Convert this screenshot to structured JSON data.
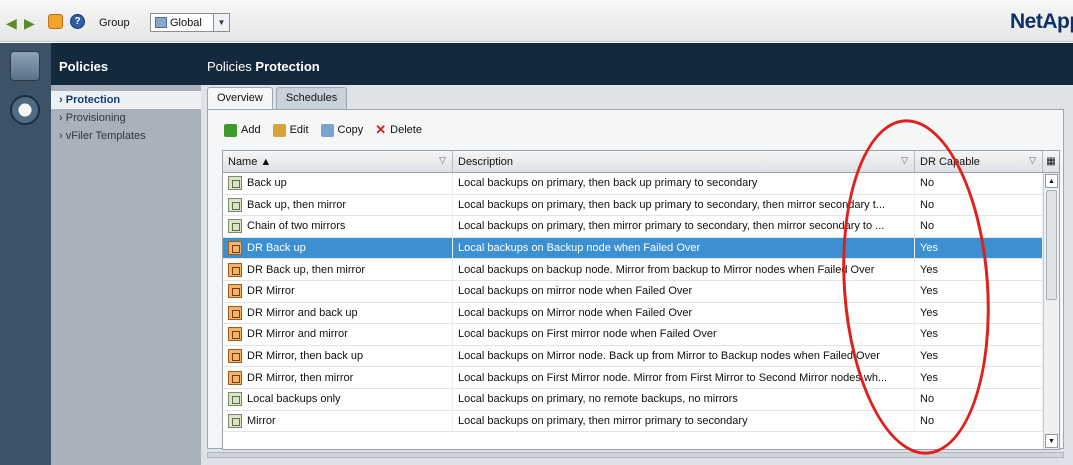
{
  "toolbar": {
    "group_label": "Group",
    "group_value": "Global",
    "brand": "NetApp"
  },
  "nav": {
    "title": "Policies",
    "items": [
      {
        "label": "Protection",
        "active": true
      },
      {
        "label": "Provisioning",
        "active": false
      },
      {
        "label": "vFiler Templates",
        "active": false
      }
    ]
  },
  "main": {
    "title_prefix": "Policies",
    "title_bold": "Protection",
    "tabs": [
      {
        "label": "Overview",
        "active": true
      },
      {
        "label": "Schedules",
        "active": false
      }
    ],
    "actions": [
      {
        "label": "Add",
        "icon": "add-icon",
        "color": "#3c9a2b"
      },
      {
        "label": "Edit",
        "icon": "edit-icon",
        "color": "#d8a43a"
      },
      {
        "label": "Copy",
        "icon": "copy-icon",
        "color": "#7aa3cf"
      },
      {
        "label": "Delete",
        "icon": "delete-icon",
        "color": "#d0201a"
      }
    ]
  },
  "table": {
    "columns": [
      "Name ▲",
      "Description",
      "DR Capable"
    ],
    "rows": [
      {
        "name": "Back up",
        "description": "Local backups on primary, then back up primary to secondary",
        "dr": "No",
        "dr_icon": false
      },
      {
        "name": "Back up, then mirror",
        "description": "Local backups on primary, then back up primary to secondary, then mirror secondary t...",
        "dr": "No",
        "dr_icon": false
      },
      {
        "name": "Chain of two mirrors",
        "description": "Local backups on primary, then mirror primary to secondary, then mirror secondary to ...",
        "dr": "No",
        "dr_icon": false
      },
      {
        "name": "DR Back up",
        "description": "Local backups on Backup node when Failed Over",
        "dr": "Yes",
        "dr_icon": true,
        "selected": true
      },
      {
        "name": "DR Back up, then mirror",
        "description": "Local backups on backup node. Mirror from backup to Mirror nodes when Failed Over",
        "dr": "Yes",
        "dr_icon": true
      },
      {
        "name": "DR Mirror",
        "description": "Local backups on mirror node when Failed Over",
        "dr": "Yes",
        "dr_icon": true
      },
      {
        "name": "DR Mirror and back up",
        "description": "Local backups on  Mirror node when Failed Over",
        "dr": "Yes",
        "dr_icon": true
      },
      {
        "name": "DR Mirror and mirror",
        "description": "Local backups on First mirror node when Failed Over",
        "dr": "Yes",
        "dr_icon": true
      },
      {
        "name": "DR Mirror, then back up",
        "description": "Local backups on Mirror node. Back up from Mirror to Backup nodes when Failed Over",
        "dr": "Yes",
        "dr_icon": true
      },
      {
        "name": "DR Mirror, then mirror",
        "description": "Local backups on First Mirror node. Mirror from First Mirror to Second Mirror nodes wh...",
        "dr": "Yes",
        "dr_icon": true
      },
      {
        "name": "Local backups only",
        "description": "Local backups on primary, no remote backups, no mirrors",
        "dr": "No",
        "dr_icon": false
      },
      {
        "name": "Mirror",
        "description": "Local backups on primary, then mirror primary to secondary",
        "dr": "No",
        "dr_icon": false
      }
    ]
  },
  "colors": {
    "nav_dark": "#15293d",
    "selection": "#3c8fd0",
    "annotation": "#e0201b"
  }
}
